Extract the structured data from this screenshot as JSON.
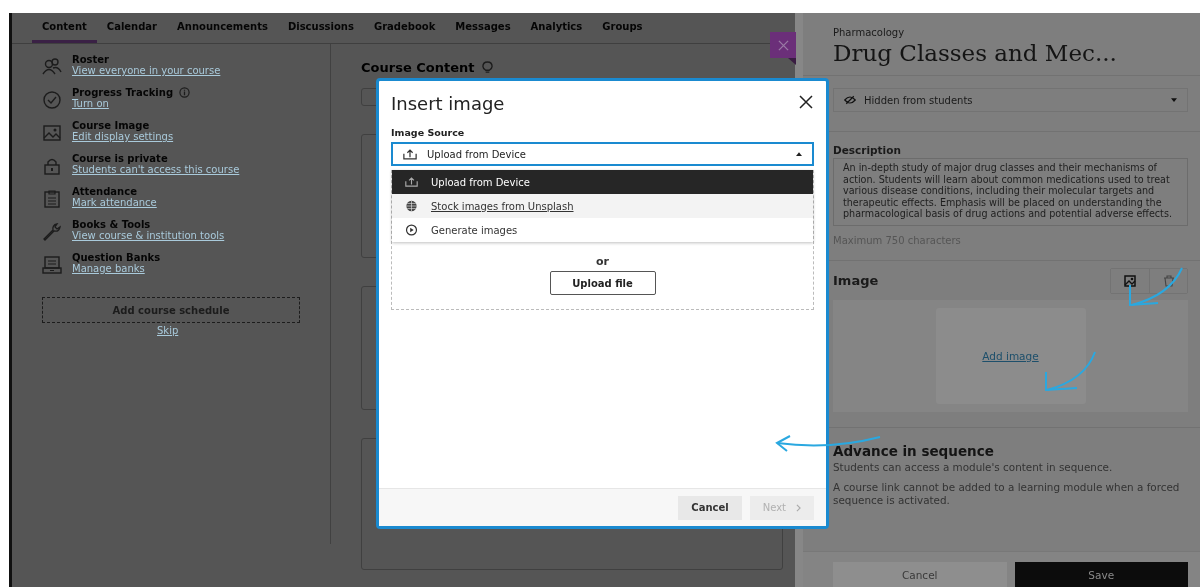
{
  "course_tabs": [
    {
      "label": "Content",
      "selected": true
    },
    {
      "label": "Calendar",
      "selected": false
    },
    {
      "label": "Announcements",
      "selected": false
    },
    {
      "label": "Discussions",
      "selected": false
    },
    {
      "label": "Gradebook",
      "selected": false
    },
    {
      "label": "Messages",
      "selected": false
    },
    {
      "label": "Analytics",
      "selected": false
    },
    {
      "label": "Groups",
      "selected": false
    }
  ],
  "sidebar_items": [
    {
      "kind": "roster",
      "title": "Roster",
      "link": "View everyone in your course",
      "info": false
    },
    {
      "kind": "progress",
      "title": "Progress Tracking",
      "link": "Turn on",
      "info": true
    },
    {
      "kind": "image",
      "title": "Course Image",
      "link": "Edit display settings",
      "info": false
    },
    {
      "kind": "private",
      "title": "Course is private",
      "link": "Students can't access this course",
      "info": false
    },
    {
      "kind": "attendance",
      "title": "Attendance",
      "link": "Mark attendance",
      "info": false
    },
    {
      "kind": "tools",
      "title": "Books & Tools",
      "link": "View course & institution tools",
      "info": false
    },
    {
      "kind": "banks",
      "title": "Question Banks",
      "link": "Manage banks",
      "info": false
    }
  ],
  "schedule_button": "Add course schedule",
  "skip_link": "Skip",
  "course_content": {
    "title": "Course Content"
  },
  "panel": {
    "breadcrumb": "Pharmacology",
    "title": "Drug Classes and Mec...",
    "visibility": "Hidden from students",
    "description_label": "Description",
    "description": "An in-depth study of major drug classes and their mechanisms of action. Students will learn about common medications used to treat various disease conditions, including their molecular targets and therapeutic effects. Emphasis will be placed on understanding the pharmacological basis of drug actions and potential adverse effects.",
    "description_hint": "Maximum 750 characters",
    "image_label": "Image",
    "add_image_link": "Add image",
    "sequence_title": "Advance in sequence",
    "sequence_text": "Students can access a module's content in sequence.",
    "sequence_note": "A course link cannot be added to a learning module when a forced sequence is activated.",
    "cancel_button": "Cancel",
    "save_button": "Save"
  },
  "dialog": {
    "title": "Insert image",
    "source_label": "Image Source",
    "source_value": "Upload from Device",
    "expanded": true,
    "source_options": [
      {
        "kind": "upload",
        "label": "Upload from Device",
        "selected": true,
        "hovered": false
      },
      {
        "kind": "stock",
        "label": "Stock images from Unsplash",
        "selected": false,
        "hovered": true
      },
      {
        "kind": "generate",
        "label": "Generate images",
        "selected": false,
        "hovered": false
      }
    ],
    "separator": "or",
    "upload_button": "Upload file",
    "buttons": [
      {
        "label": "Cancel",
        "disabled": false,
        "chevron": false
      },
      {
        "label": "Next",
        "disabled": true,
        "chevron": true
      }
    ]
  }
}
